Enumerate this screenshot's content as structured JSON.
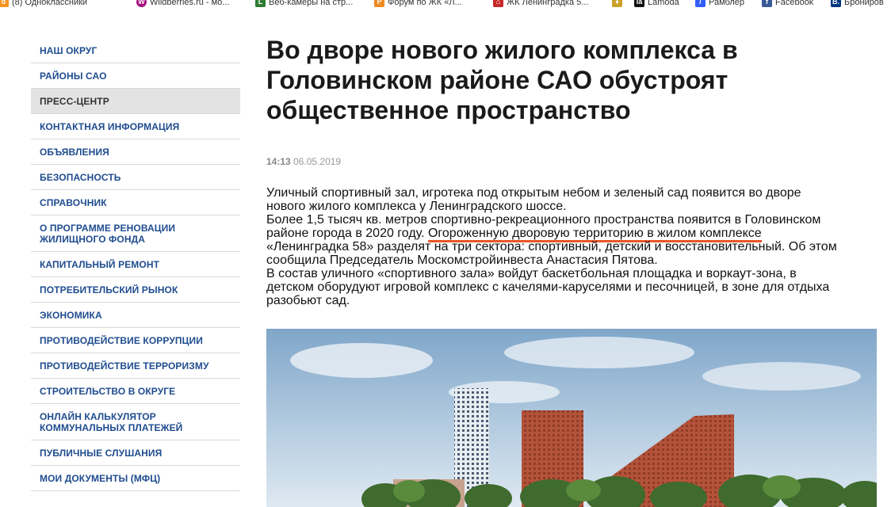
{
  "bookmarks": [
    {
      "label": "(8) Одноклассники",
      "icon": "odnoklassniki-icon",
      "color": "#f7931e"
    },
    {
      "label": "Wildberries.ru - мо...",
      "icon": "wildberries-icon",
      "color": "#a5137f"
    },
    {
      "label": "Веб-камеры на стр...",
      "icon": "webcam-icon",
      "color": "#2e7d32"
    },
    {
      "label": "Форум по ЖК «Л...",
      "icon": "forum-icon",
      "color": "#f08a24"
    },
    {
      "label": "ЖК Ленинградка 5...",
      "icon": "house-icon",
      "color": "#c62828"
    },
    {
      "label": "",
      "icon": "emblem-icon",
      "color": "#c9a227"
    },
    {
      "label": "Lamoda",
      "icon": "lamoda-icon",
      "color": "#111111"
    },
    {
      "label": "Рамблер",
      "icon": "rambler-icon",
      "color": "#315efb"
    },
    {
      "label": "Facebook",
      "icon": "facebook-icon",
      "color": "#3b5998"
    },
    {
      "label": "Брониров",
      "icon": "booking-icon",
      "color": "#003580"
    }
  ],
  "sidebar": {
    "items": [
      {
        "label": "НАШ ОКРУГ"
      },
      {
        "label": "РАЙОНЫ САО"
      },
      {
        "label": "ПРЕСС-ЦЕНТР",
        "active": true
      },
      {
        "label": "КОНТАКТНАЯ ИНФОРМАЦИЯ"
      },
      {
        "label": "ОБЪЯВЛЕНИЯ"
      },
      {
        "label": "БЕЗОПАСНОСТЬ"
      },
      {
        "label": "СПРАВОЧНИК"
      },
      {
        "label": "О ПРОГРАММЕ РЕНОВАЦИИ ЖИЛИЩНОГО ФОНДА"
      },
      {
        "label": "КАПИТАЛЬНЫЙ РЕМОНТ"
      },
      {
        "label": "ПОТРЕБИТЕЛЬСКИЙ РЫНОК"
      },
      {
        "label": "ЭКОНОМИКА"
      },
      {
        "label": "ПРОТИВОДЕЙСТВИЕ КОРРУПЦИИ"
      },
      {
        "label": "ПРОТИВОДЕЙСТВИЕ ТЕРРОРИЗМУ"
      },
      {
        "label": "СТРОИТЕЛЬСТВО В ОКРУГЕ"
      },
      {
        "label": "ОНЛАЙН КАЛЬКУЛЯТОР КОММУНАЛЬНЫХ ПЛАТЕЖЕЙ"
      },
      {
        "label": "ПУБЛИЧНЫЕ СЛУШАНИЯ"
      },
      {
        "label": "МОИ ДОКУМЕНТЫ (МФЦ)"
      }
    ]
  },
  "article": {
    "title": "Во дворе нового жилого комплекса в Головинском районе САО обустроят общественное пространство",
    "time": "14:13",
    "date": "06.05.2019",
    "p1": "Уличный спортивный зал, игротека под открытым небом и зеленый сад появится во дворе",
    "p1b": "нового жилого комплекса у Ленинградского шоссе.",
    "p2a": "Более 1,5 тысяч кв. метров спортивно-рекреационного пространства появится в Головинском",
    "p2b_pre": "районе города в 2020 году. ",
    "p2b_underlined": "Огороженную дворовую территорию в жилом комплексе",
    "p2c": "«Ленинградка 58» разделят на три сектора: спортивный, детский и восстановительный. Об этом",
    "p2d": "сообщила Председатель Москомстройинвеста Анастасия Пятова.",
    "p3a": "В состав уличного «спортивного зала» войдут баскетбольная площадка и воркаут-зона, в",
    "p3b": "детском оборудуют игровой комплекс с качелями-каруселями и песочницей, в зоне для отдыха",
    "p3c": "разобьют сад."
  },
  "colors": {
    "nav_link": "#1f4c8f",
    "active_bg": "#e3e3e3",
    "underline": "#e8562a"
  }
}
